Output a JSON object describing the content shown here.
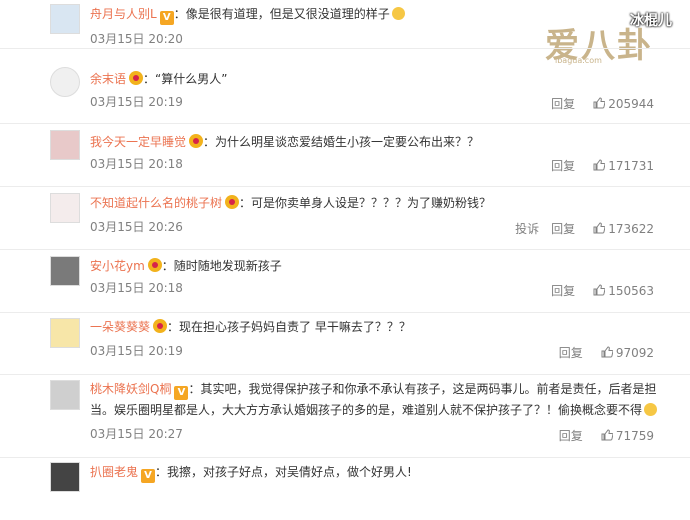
{
  "watermark": {
    "title": "冰棍儿",
    "logo": "爱八卦",
    "url": "ibagua.com"
  },
  "comments": [
    {
      "name": "舟月与人别L",
      "badge": "v",
      "text": "：像是很有道理，但是又很没道理的样子",
      "time": "03月15日 20:20",
      "reply": "",
      "likes": "",
      "report": ""
    },
    {
      "name": "余末语",
      "badge": "crown",
      "text": "：“算什么男人”",
      "time": "03月15日 20:19",
      "reply": "回复",
      "likes": "205944",
      "report": ""
    },
    {
      "name": "我今天一定早睡觉",
      "badge": "crown",
      "text": "：为什么明星谈恋爱结婚生小孩一定要公布出来？？",
      "time": "03月15日 20:18",
      "reply": "回复",
      "likes": "171731",
      "report": ""
    },
    {
      "name": "不知道起什么名的桃子树",
      "badge": "crown",
      "text": "：可是你卖单身人设是？？？？为了赚奶粉钱？",
      "time": "03月15日 20:26",
      "reply": "回复",
      "likes": "173622",
      "report": "投诉"
    },
    {
      "name": "安小花ym",
      "badge": "crown",
      "text": "：随时随地发现新孩子",
      "time": "03月15日 20:18",
      "reply": "回复",
      "likes": "150563",
      "report": ""
    },
    {
      "name": "一朵葵葵葵",
      "badge": "crown",
      "text": "：现在担心孩子妈妈自责了 早干嘛去了？？？",
      "time": "03月15日 20:19",
      "reply": "回复",
      "likes": "97092",
      "report": ""
    },
    {
      "name": "桃木降妖剑Q桐",
      "badge": "v",
      "text": "：其实吧，我觉得保护孩子和你承不承认有孩子，这是两码事儿。前者是责任，后者是担",
      "text2": "当。娱乐圈明星都是人，大大方方承认婚姻孩子的多的是，难道别人就不保护孩子了？！偷换概念要不得",
      "time": "03月15日 20:27",
      "reply": "回复",
      "likes": "71759",
      "report": ""
    },
    {
      "name": "扒圈老鬼",
      "badge": "v",
      "text": "：我擦，对孩子好点，对吴倩好点，做个好男人!",
      "time": "",
      "reply": "",
      "likes": "",
      "report": ""
    }
  ]
}
